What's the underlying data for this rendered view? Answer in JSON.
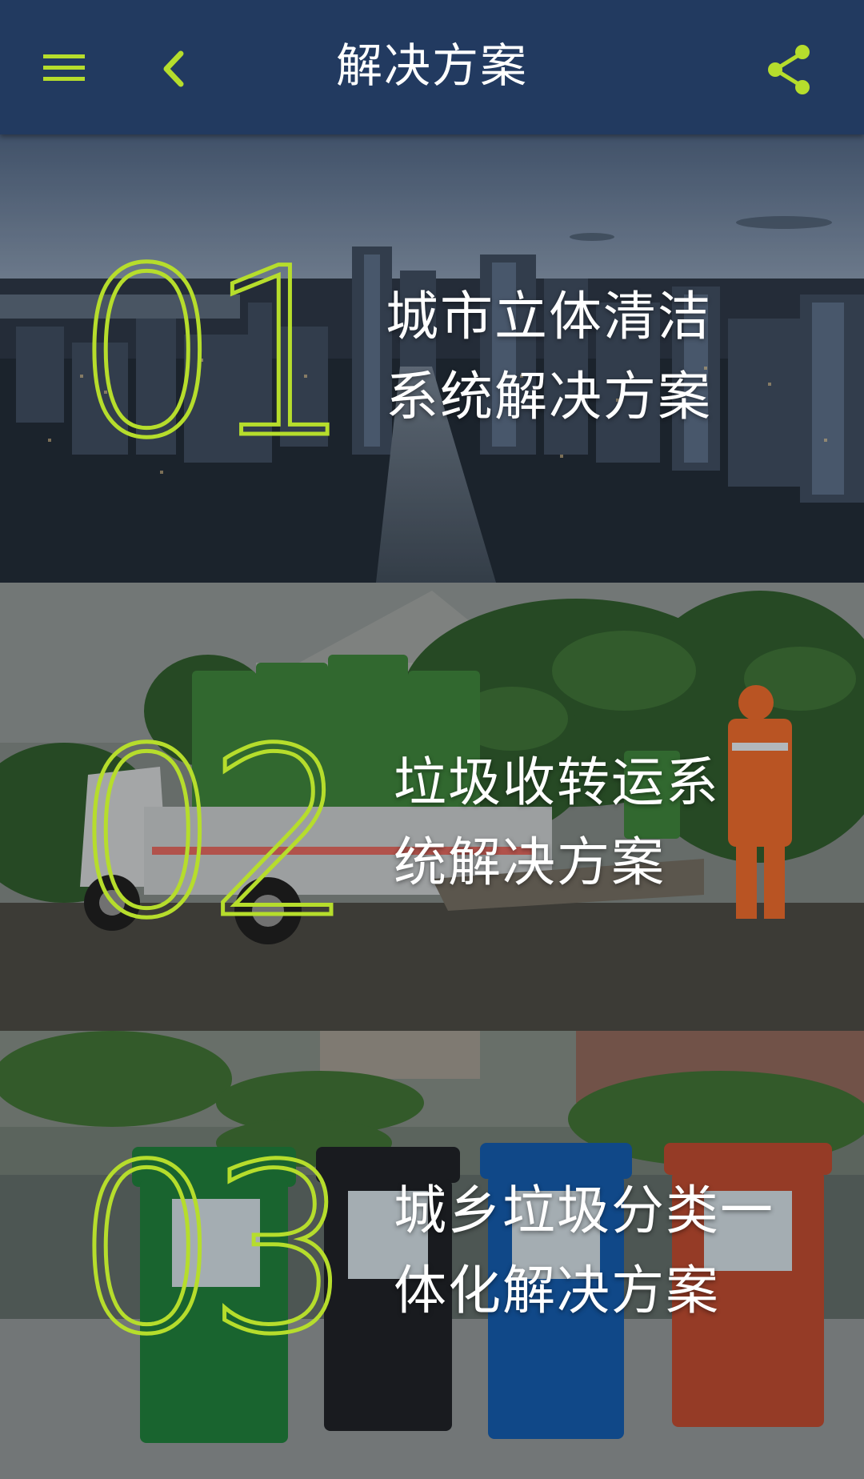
{
  "header": {
    "title": "解决方案",
    "menu_icon": "hamburger-menu-icon",
    "back_icon": "chevron-left-icon",
    "share_icon": "share-icon",
    "accent_color": "#b6dd2c",
    "background_color": "#223a60"
  },
  "solutions": [
    {
      "number": "01",
      "title_line1": "城市立体清洁",
      "title_line2": "系统解决方案",
      "image": "city-skyline-at-dusk"
    },
    {
      "number": "02",
      "title_line1": "垃圾收转运系",
      "title_line2": "统解决方案",
      "image": "garbage-truck-and-sanitation-worker"
    },
    {
      "number": "03",
      "title_line1": "城乡垃圾分类一",
      "title_line2": "体化解决方案",
      "image": "four-sorting-bins"
    }
  ]
}
